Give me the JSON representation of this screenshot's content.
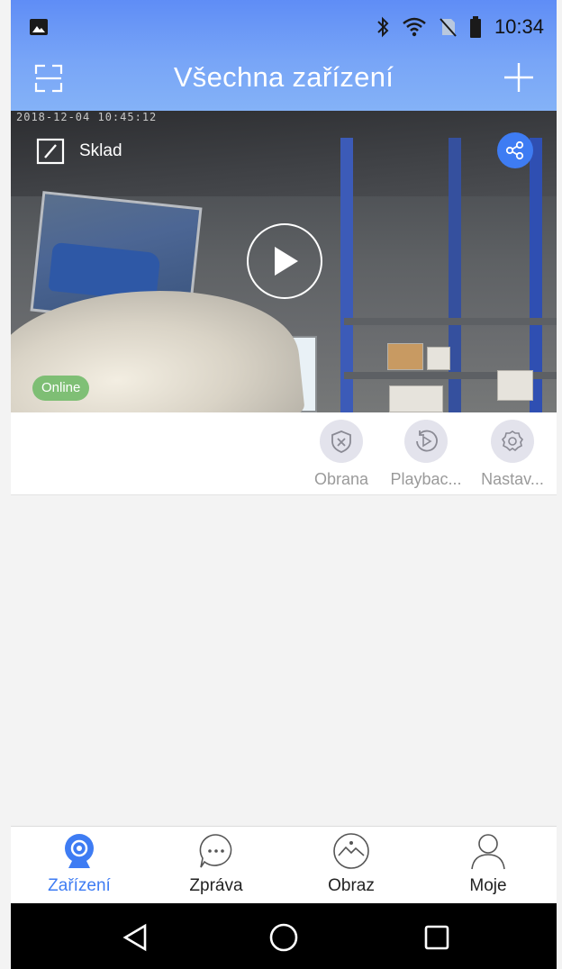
{
  "status_bar": {
    "time": "10:34"
  },
  "header": {
    "title": "Všechna zařízení"
  },
  "camera": {
    "name": "Sklad",
    "timestamp": "2018-12-04  10:45:12",
    "status": "Online",
    "actions": [
      {
        "label": "Obrana",
        "icon": "shield-x-icon"
      },
      {
        "label": "Playbac...",
        "icon": "playback-icon"
      },
      {
        "label": "Nastav...",
        "icon": "settings-icon"
      }
    ]
  },
  "tabs": [
    {
      "label": "Zařízení",
      "icon": "camera-icon",
      "active": true
    },
    {
      "label": "Zpráva",
      "icon": "message-icon",
      "active": false
    },
    {
      "label": "Obraz",
      "icon": "image-icon",
      "active": false
    },
    {
      "label": "Moje",
      "icon": "user-icon",
      "active": false
    }
  ],
  "colors": {
    "accent": "#3e7cf3",
    "header": "#6c98f6",
    "online": "#6cb864"
  }
}
